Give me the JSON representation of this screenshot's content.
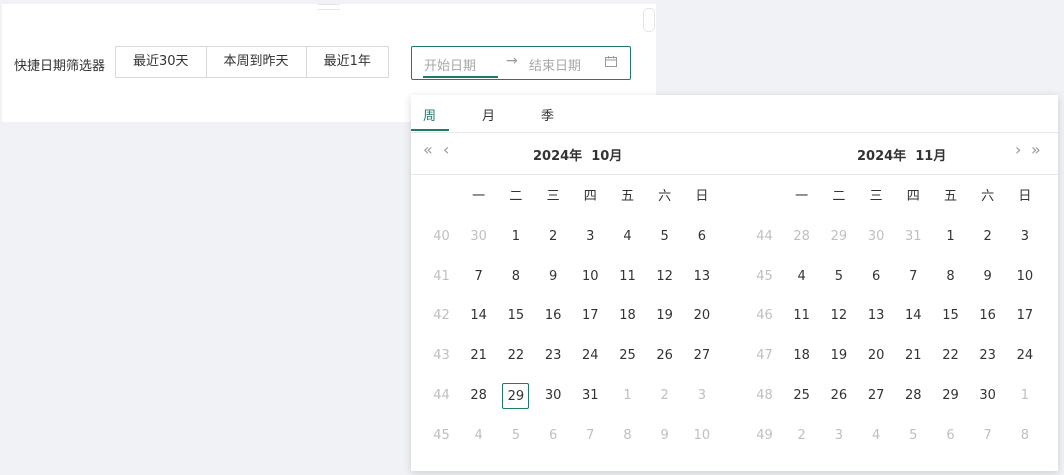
{
  "filter": {
    "label": "快捷日期筛选器",
    "quick_buttons": [
      "最近30天",
      "本周到昨天",
      "最近1年"
    ]
  },
  "range_picker": {
    "start_placeholder": "开始日期",
    "separator": "→",
    "end_placeholder": "结束日期",
    "icon": "calendar-icon"
  },
  "panel": {
    "tabs": [
      "周",
      "月",
      "季"
    ],
    "active_tab": "周",
    "nav_icons": [
      "double-left-icon",
      "left-icon",
      "right-icon",
      "double-right-icon"
    ],
    "accent_color": "#1f7a6c",
    "weekday_headers": [
      "一",
      "二",
      "三",
      "四",
      "五",
      "六",
      "日"
    ],
    "calendars": [
      {
        "year": "2024年",
        "month": "10月",
        "rows": [
          {
            "week": "40",
            "days": [
              {
                "d": "30",
                "dim": true
              },
              {
                "d": "1"
              },
              {
                "d": "2"
              },
              {
                "d": "3"
              },
              {
                "d": "4"
              },
              {
                "d": "5"
              },
              {
                "d": "6"
              }
            ]
          },
          {
            "week": "41",
            "days": [
              {
                "d": "7"
              },
              {
                "d": "8"
              },
              {
                "d": "9"
              },
              {
                "d": "10"
              },
              {
                "d": "11"
              },
              {
                "d": "12"
              },
              {
                "d": "13"
              }
            ]
          },
          {
            "week": "42",
            "days": [
              {
                "d": "14"
              },
              {
                "d": "15"
              },
              {
                "d": "16"
              },
              {
                "d": "17"
              },
              {
                "d": "18"
              },
              {
                "d": "19"
              },
              {
                "d": "20"
              }
            ]
          },
          {
            "week": "43",
            "days": [
              {
                "d": "21"
              },
              {
                "d": "22"
              },
              {
                "d": "23"
              },
              {
                "d": "24"
              },
              {
                "d": "25"
              },
              {
                "d": "26"
              },
              {
                "d": "27"
              }
            ]
          },
          {
            "week": "44",
            "days": [
              {
                "d": "28"
              },
              {
                "d": "29",
                "today": true
              },
              {
                "d": "30"
              },
              {
                "d": "31"
              },
              {
                "d": "1",
                "dim": true
              },
              {
                "d": "2",
                "dim": true
              },
              {
                "d": "3",
                "dim": true
              }
            ]
          },
          {
            "week": "45",
            "days": [
              {
                "d": "4",
                "dim": true
              },
              {
                "d": "5",
                "dim": true
              },
              {
                "d": "6",
                "dim": true
              },
              {
                "d": "7",
                "dim": true
              },
              {
                "d": "8",
                "dim": true
              },
              {
                "d": "9",
                "dim": true
              },
              {
                "d": "10",
                "dim": true
              }
            ]
          }
        ]
      },
      {
        "year": "2024年",
        "month": "11月",
        "rows": [
          {
            "week": "44",
            "days": [
              {
                "d": "28",
                "dim": true
              },
              {
                "d": "29",
                "dim": true
              },
              {
                "d": "30",
                "dim": true
              },
              {
                "d": "31",
                "dim": true
              },
              {
                "d": "1"
              },
              {
                "d": "2"
              },
              {
                "d": "3"
              }
            ]
          },
          {
            "week": "45",
            "days": [
              {
                "d": "4"
              },
              {
                "d": "5"
              },
              {
                "d": "6"
              },
              {
                "d": "7"
              },
              {
                "d": "8"
              },
              {
                "d": "9"
              },
              {
                "d": "10"
              }
            ]
          },
          {
            "week": "46",
            "days": [
              {
                "d": "11"
              },
              {
                "d": "12"
              },
              {
                "d": "13"
              },
              {
                "d": "14"
              },
              {
                "d": "15"
              },
              {
                "d": "16"
              },
              {
                "d": "17"
              }
            ]
          },
          {
            "week": "47",
            "days": [
              {
                "d": "18"
              },
              {
                "d": "19"
              },
              {
                "d": "20"
              },
              {
                "d": "21"
              },
              {
                "d": "22"
              },
              {
                "d": "23"
              },
              {
                "d": "24"
              }
            ]
          },
          {
            "week": "48",
            "days": [
              {
                "d": "25"
              },
              {
                "d": "26"
              },
              {
                "d": "27"
              },
              {
                "d": "28"
              },
              {
                "d": "29"
              },
              {
                "d": "30"
              },
              {
                "d": "1",
                "dim": true
              }
            ]
          },
          {
            "week": "49",
            "days": [
              {
                "d": "2",
                "dim": true
              },
              {
                "d": "3",
                "dim": true
              },
              {
                "d": "4",
                "dim": true
              },
              {
                "d": "5",
                "dim": true
              },
              {
                "d": "6",
                "dim": true
              },
              {
                "d": "7",
                "dim": true
              },
              {
                "d": "8",
                "dim": true
              }
            ]
          }
        ]
      }
    ]
  }
}
